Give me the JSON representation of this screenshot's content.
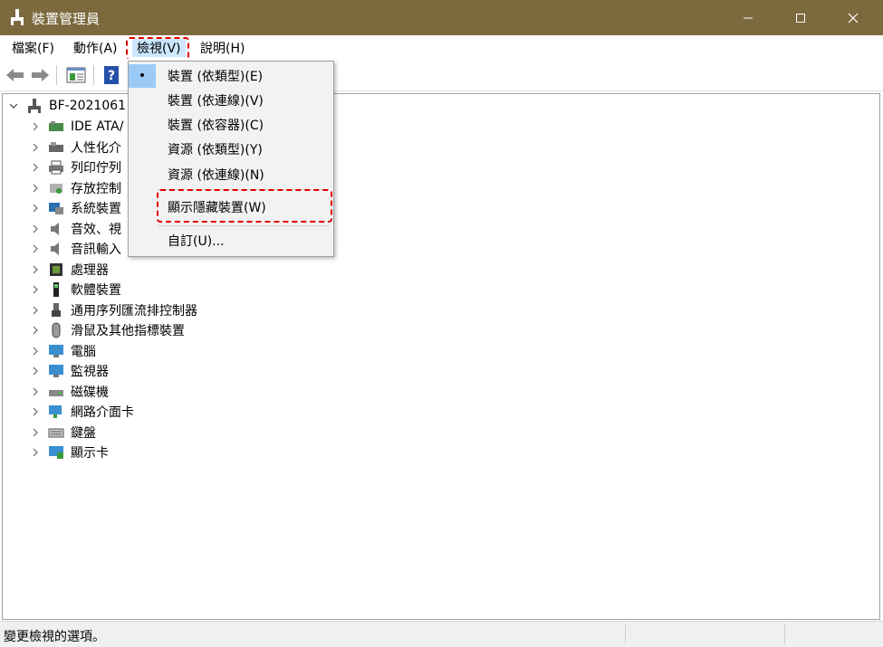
{
  "window": {
    "title": "裝置管理員",
    "controls": {
      "minimize": "—",
      "maximize": "☐",
      "close": "✕"
    }
  },
  "menu": {
    "file": "檔案(F)",
    "action": "動作(A)",
    "view": "檢視(V)",
    "help": "說明(H)"
  },
  "toolbar": {
    "icons": [
      "back-arrow-icon",
      "forward-arrow-icon",
      "properties-icon",
      "help-icon"
    ]
  },
  "tree": {
    "root": "BF-2021061",
    "items": [
      {
        "label": "IDE ATA/",
        "icon": "ide-controller-icon"
      },
      {
        "label": "人性化介",
        "icon": "hid-icon"
      },
      {
        "label": "列印佇列",
        "icon": "printer-icon"
      },
      {
        "label": "存放控制",
        "icon": "storage-controller-icon"
      },
      {
        "label": "系統裝置",
        "icon": "system-device-icon"
      },
      {
        "label": "音效、視",
        "icon": "speaker-icon"
      },
      {
        "label": "音訊輸入",
        "icon": "audio-input-icon"
      },
      {
        "label": "處理器",
        "icon": "processor-icon"
      },
      {
        "label": "軟體裝置",
        "icon": "software-device-icon"
      },
      {
        "label": "通用序列匯流排控制器",
        "icon": "usb-icon"
      },
      {
        "label": "滑鼠及其他指標裝置",
        "icon": "mouse-icon"
      },
      {
        "label": "電腦",
        "icon": "computer-icon"
      },
      {
        "label": "監視器",
        "icon": "monitor-icon"
      },
      {
        "label": "磁碟機",
        "icon": "disk-drive-icon"
      },
      {
        "label": "網路介面卡",
        "icon": "network-adapter-icon"
      },
      {
        "label": "鍵盤",
        "icon": "keyboard-icon"
      },
      {
        "label": "顯示卡",
        "icon": "display-adapter-icon"
      }
    ]
  },
  "view_menu": {
    "bullet": "•",
    "items": {
      "by_type": "裝置 (依類型)(E)",
      "by_connection": "裝置 (依連線)(V)",
      "by_container": "裝置 (依容器)(C)",
      "res_by_type": "資源 (依類型)(Y)",
      "res_by_connection": "資源 (依連線)(N)",
      "show_hidden": "顯示隱藏裝置(W)",
      "customize": "自訂(U)..."
    }
  },
  "status": {
    "text": "變更檢視的選項。"
  },
  "colors": {
    "titlebar": "#7c6a3e",
    "highlight": "#e00000",
    "selection": "#9ccaf7"
  }
}
